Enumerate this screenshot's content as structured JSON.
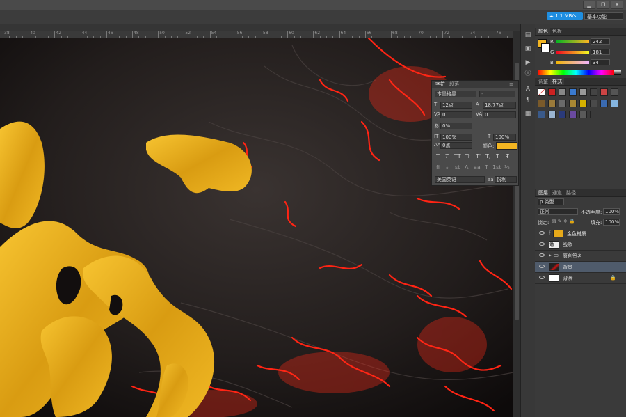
{
  "window": {
    "buttons": [
      "▁",
      "❐",
      "✕"
    ]
  },
  "topbar": {
    "speed": "1.1 MB/s",
    "workspace": "基本功能"
  },
  "ruler": {
    "ticks": [
      "38",
      "40",
      "42",
      "44",
      "46",
      "48",
      "50",
      "52",
      "54",
      "56",
      "58",
      "60",
      "62",
      "64",
      "66",
      "68",
      "70",
      "72",
      "74",
      "76"
    ]
  },
  "color_panel": {
    "tabs": [
      "颜色",
      "色板"
    ],
    "r_label": "R",
    "g_label": "G",
    "b_label": "B",
    "r": "242",
    "g": "181",
    "b": "34",
    "fg_color": "#f2b522"
  },
  "styles_panel": {
    "tabs": [
      "调整",
      "样式"
    ]
  },
  "layers_panel": {
    "tabs": [
      "图层",
      "通道",
      "路径"
    ],
    "filter": "ρ 类型",
    "blend_mode": "正常",
    "opacity_label": "不透明度:",
    "opacity": "100%",
    "lock_label": "锁定:",
    "fill_label": "填充:",
    "fill": "100%",
    "layers": [
      {
        "name": "金色材质",
        "type": "gold",
        "fx": "f"
      },
      {
        "name": "战歌.",
        "type": "text"
      },
      {
        "name": "原创签名",
        "type": "folder"
      },
      {
        "name": "背景",
        "type": "lava"
      },
      {
        "name": "背景",
        "type": "white"
      }
    ]
  },
  "char_panel": {
    "tabs": [
      "字符",
      "段落"
    ],
    "font": "本墨格黑",
    "style": "-",
    "size": "12点",
    "leading": "18.77点",
    "kerning": "0",
    "tracking": "0",
    "tsume": "0%",
    "v_scale": "100%",
    "h_scale": "100%",
    "baseline": "0点",
    "color_label": "颜色:",
    "color": "#f2b522",
    "language": "美国英语",
    "aa_label": "aa",
    "aa": "锐利",
    "style_buttons": [
      "T",
      "T",
      "TT",
      "Tr",
      "T'",
      "T,",
      "T",
      "Ŧ"
    ],
    "opentype_buttons": [
      "fi",
      "ℴ",
      "st",
      "A",
      "aa",
      "T",
      "1st",
      "½"
    ]
  },
  "canvas": {
    "gold": "#e6a91a",
    "lava": "#ff1a10"
  }
}
